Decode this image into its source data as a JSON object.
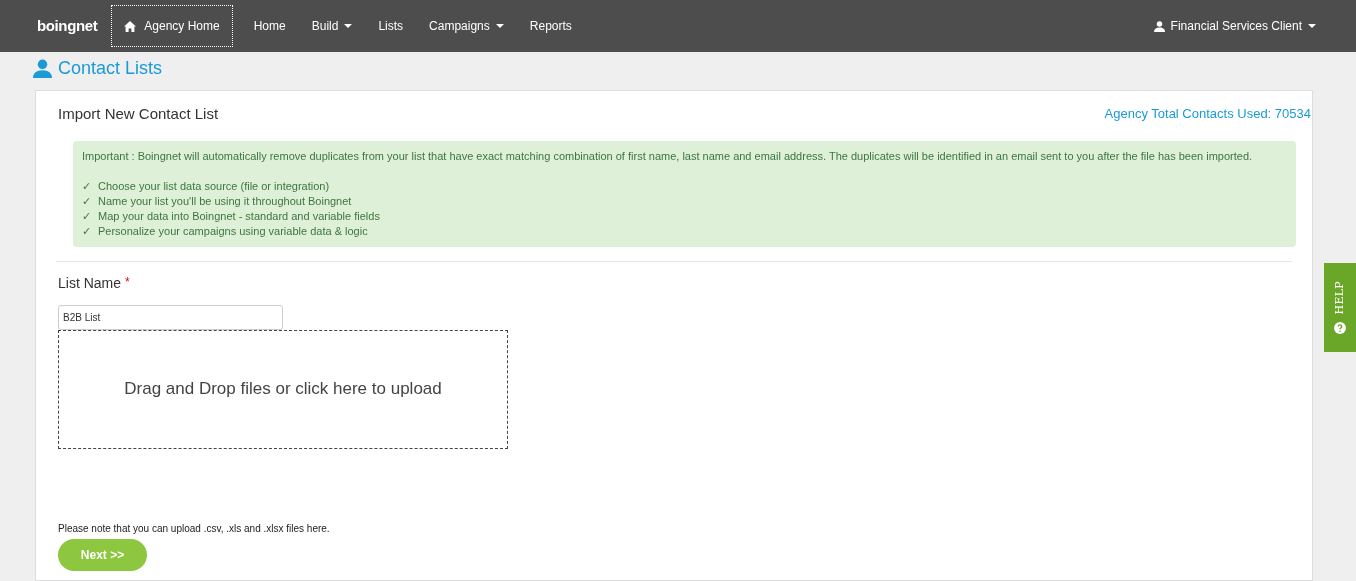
{
  "navbar": {
    "logo": "boingnet",
    "items": [
      {
        "label": "Agency Home",
        "selected": true,
        "dropdown": false,
        "kind": "home"
      },
      {
        "label": "Home",
        "selected": false,
        "dropdown": false,
        "kind": "link"
      },
      {
        "label": "Build",
        "selected": false,
        "dropdown": true,
        "kind": "link"
      },
      {
        "label": "Lists",
        "selected": false,
        "dropdown": false,
        "kind": "link"
      },
      {
        "label": "Campaigns",
        "selected": false,
        "dropdown": true,
        "kind": "link"
      },
      {
        "label": "Reports",
        "selected": false,
        "dropdown": false,
        "kind": "link"
      }
    ],
    "user": {
      "label": "Financial Services Client",
      "dropdown": true
    }
  },
  "page_title": "Contact Lists",
  "card": {
    "title": "Import New Contact List",
    "total_contacts": "Agency Total Contacts Used: 70534",
    "notice": {
      "text": "Important : Boingnet will automatically remove duplicates from your list that have exact matching combination of first name, last name and email address. The duplicates will be identified in an email sent to you after the file has been imported.",
      "steps": [
        {
          "mark": "✓",
          "text": "Choose your list data source (file or integration)"
        },
        {
          "mark": "✓",
          "text": "Name your list you'll be using it throughout Boingnet"
        },
        {
          "mark": "✓",
          "text": "Map your data into Boingnet - standard and variable fields"
        },
        {
          "mark": "✓",
          "text": "Personalize your campaigns using variable data & logic"
        }
      ]
    },
    "list_name": {
      "label": "List Name",
      "required_mark": "*",
      "value": "B2B List"
    },
    "dropzone": "Drag and Drop files or click here to upload",
    "note": "Please note that you can upload .csv, .xls and .xlsx files here.",
    "next_button": "Next >>"
  },
  "help_tab": "HELP"
}
